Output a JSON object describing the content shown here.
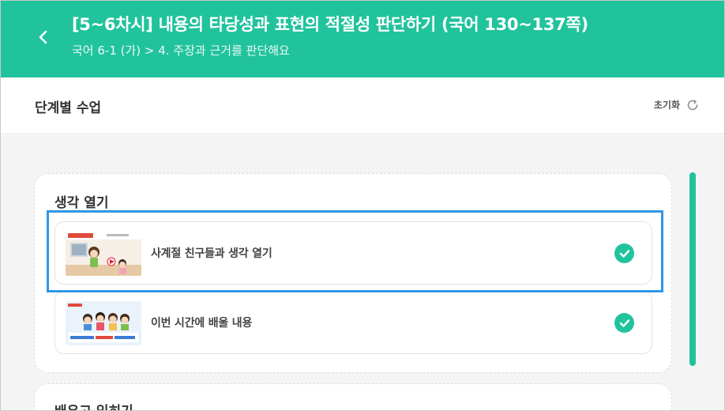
{
  "header": {
    "title": "[5~6차시] 내용의 타당성과 표현의 적절성 판단하기 (국어 130~137쪽)",
    "breadcrumb": "국어 6-1 (가) > 4. 주장과 근거를 판단해요",
    "back_icon": "chevron-left-icon"
  },
  "section": {
    "title": "단계별 수업",
    "reset_label": "초기화",
    "reset_icon": "refresh-icon"
  },
  "cards": [
    {
      "title": "생각 열기",
      "lessons": [
        {
          "label": "사계절 친구들과 생각 열기",
          "completed": true,
          "thumbnail": "classroom-scene-thumbnail"
        },
        {
          "label": "이번 시간에 배울 내용",
          "completed": true,
          "thumbnail": "students-lesson-thumbnail"
        }
      ]
    },
    {
      "title": "배우고 익히기"
    }
  ],
  "colors": {
    "brand": "#21c39c",
    "highlight": "#2f97e6",
    "background": "#f4f4f5"
  }
}
